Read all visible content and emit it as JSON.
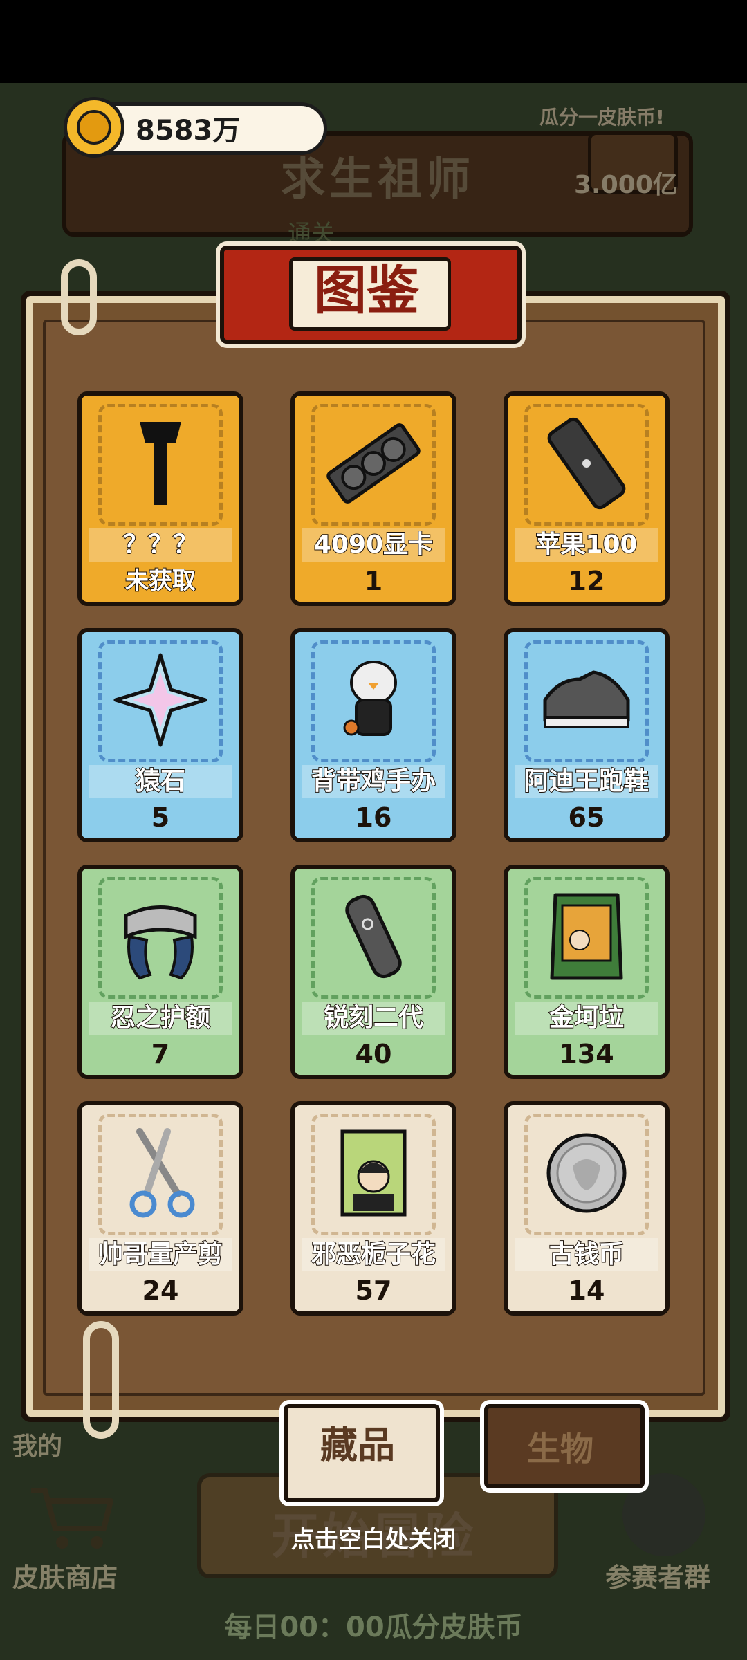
{
  "header": {
    "coin_value": "8583万",
    "background_title": "求生祖师",
    "background_subtitle": "通关",
    "prize_label": "瓜分一皮肤币!",
    "prize_value": "3.000亿"
  },
  "dialog": {
    "title": "图鉴",
    "items": [
      {
        "name": "？？？",
        "count": "未获取",
        "color": "orange",
        "icon": "mystery-silhouette-icon"
      },
      {
        "name": "4090显卡",
        "count": "1",
        "color": "orange",
        "icon": "graphics-card-icon"
      },
      {
        "name": "苹果100",
        "count": "12",
        "color": "orange",
        "icon": "phone-icon"
      },
      {
        "name": "猿石",
        "count": "5",
        "color": "blue",
        "icon": "crystal-star-icon"
      },
      {
        "name": "背带鸡手办",
        "count": "16",
        "color": "blue",
        "icon": "chicken-figurine-icon"
      },
      {
        "name": "阿迪王跑鞋",
        "count": "65",
        "color": "blue",
        "icon": "sneaker-icon"
      },
      {
        "name": "忍之护额",
        "count": "7",
        "color": "green",
        "icon": "ninja-headband-icon"
      },
      {
        "name": "锐刻二代",
        "count": "40",
        "color": "green",
        "icon": "e-cigarette-icon"
      },
      {
        "name": "金坷垃",
        "count": "134",
        "color": "green",
        "icon": "fertilizer-bag-icon"
      },
      {
        "name": "帅哥量产剪",
        "count": "24",
        "color": "beige",
        "icon": "scissors-icon"
      },
      {
        "name": "邪恶栀子花",
        "count": "57",
        "color": "beige",
        "icon": "book-icon"
      },
      {
        "name": "古钱币",
        "count": "14",
        "color": "beige",
        "icon": "coin-icon"
      }
    ],
    "tabs": {
      "collect": "藏品",
      "creature": "生物"
    },
    "close_hint": "点击空白处关闭"
  },
  "bottom": {
    "start_button": "开始冒险",
    "my_label": "我的",
    "shop_label": "皮肤商店",
    "group_label": "参赛者群",
    "daily_label": "每日00：00瓜分皮肤币"
  },
  "colors": {
    "orange": "#efaa2a",
    "blue": "#8ccdeb",
    "green": "#a4d49a",
    "beige": "#efe3cf",
    "banner_red": "#b32614"
  }
}
